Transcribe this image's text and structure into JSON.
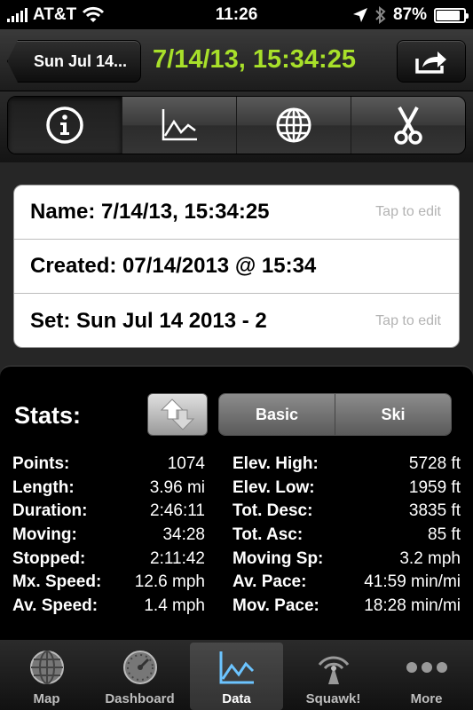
{
  "status_bar": {
    "carrier": "AT&T",
    "time": "11:26",
    "battery": "87%",
    "battery_level": 0.87,
    "icons": [
      "signal-bars-icon",
      "wifi-icon",
      "location-arrow-icon",
      "bluetooth-icon",
      "battery-icon"
    ]
  },
  "nav": {
    "back_label": "Sun Jul 14...",
    "title": "7/14/13, 15:34:25",
    "title_color": "#a8e02a",
    "share_icon": "share-icon"
  },
  "toolbar": {
    "items": [
      {
        "icon": "info-icon",
        "active": true
      },
      {
        "icon": "chart-icon",
        "active": false
      },
      {
        "icon": "globe-icon",
        "active": false
      },
      {
        "icon": "scissors-icon",
        "active": false
      }
    ]
  },
  "info": {
    "name": "Name: 7/14/13, 15:34:25",
    "created": "Created: 07/14/2013 @ 15:34",
    "set": "Set: Sun Jul 14 2013 - 2",
    "tap_to_edit": "Tap to edit"
  },
  "stats": {
    "title": "Stats:",
    "modes": [
      "Basic",
      "Ski"
    ],
    "left": [
      {
        "label": "Points:",
        "value": "1074"
      },
      {
        "label": "Length:",
        "value": "3.96 mi"
      },
      {
        "label": "Duration:",
        "value": "2:46:11"
      },
      {
        "label": "Moving:",
        "value": "34:28"
      },
      {
        "label": "Stopped:",
        "value": "2:11:42"
      },
      {
        "label": "Mx. Speed:",
        "value": "12.6 mph"
      },
      {
        "label": "Av. Speed:",
        "value": "1.4 mph"
      }
    ],
    "right": [
      {
        "label": "Elev. High:",
        "value": "5728 ft"
      },
      {
        "label": "Elev. Low:",
        "value": "1959 ft"
      },
      {
        "label": "Tot. Desc:",
        "value": "3835 ft"
      },
      {
        "label": "Tot. Asc:",
        "value": "85 ft"
      },
      {
        "label": "Moving Sp:",
        "value": "3.2 mph"
      },
      {
        "label": "Av. Pace:",
        "value": "41:59 min/mi"
      },
      {
        "label": "Mov. Pace:",
        "value": "18:28 min/mi"
      }
    ]
  },
  "tabbar": {
    "items": [
      {
        "label": "Map",
        "icon": "globe-icon",
        "active": false
      },
      {
        "label": "Dashboard",
        "icon": "gauge-icon",
        "active": false
      },
      {
        "label": "Data",
        "icon": "chart-icon",
        "active": true
      },
      {
        "label": "Squawk!",
        "icon": "broadcast-icon",
        "active": false
      },
      {
        "label": "More",
        "icon": "more-icon",
        "active": false
      }
    ]
  }
}
